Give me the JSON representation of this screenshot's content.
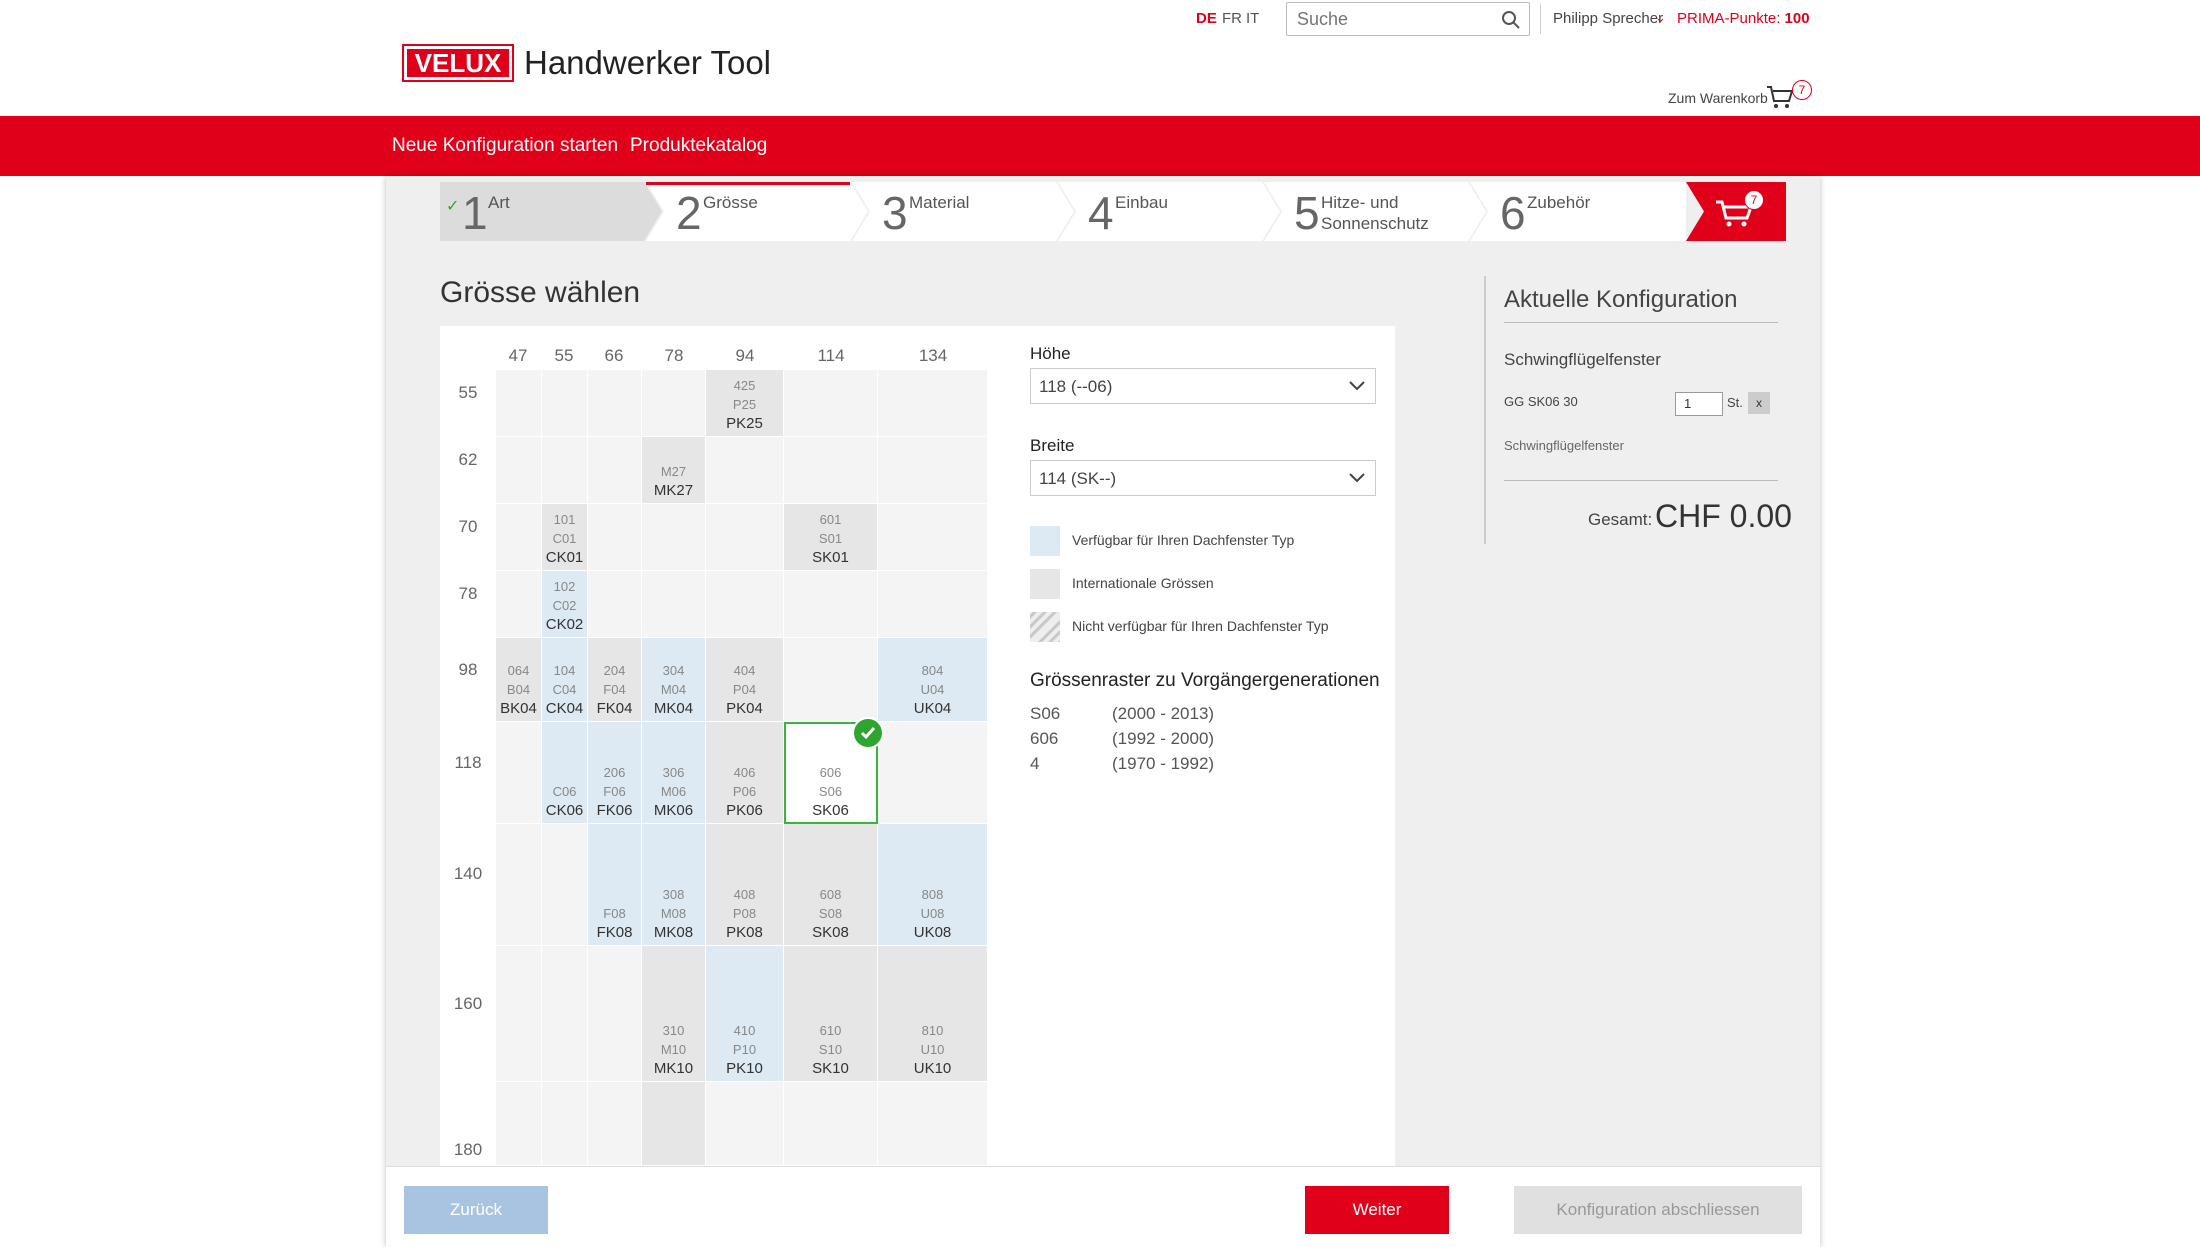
{
  "header": {
    "logo": "VELUX",
    "app_title": "Handwerker Tool",
    "languages": [
      "DE",
      "FR",
      "IT"
    ],
    "search_placeholder": "Suche",
    "user_name": "Philipp Sprecher",
    "points_label": "PRIMA-Punkte:",
    "points_value": "100",
    "cart_link": "Zum Warenkorb",
    "cart_count": "7"
  },
  "nav": {
    "new_config": "Neue Konfiguration starten",
    "catalog": "Produktekatalog"
  },
  "steps": [
    {
      "num": "1",
      "label": "Art"
    },
    {
      "num": "2",
      "label": "Grösse"
    },
    {
      "num": "3",
      "label": "Material"
    },
    {
      "num": "4",
      "label": "Einbau"
    },
    {
      "num": "5",
      "label": "Hitze- und Sonnenschutz"
    },
    {
      "num": "6",
      "label": "Zubehör"
    }
  ],
  "steps_cart_count": "7",
  "section_title": "Grösse wählen",
  "grid": {
    "columns": [
      "47",
      "55",
      "66",
      "78",
      "94",
      "114",
      "134"
    ],
    "rows": [
      "55",
      "62",
      "70",
      "78",
      "98",
      "118",
      "140",
      "160",
      "180"
    ],
    "cells": [
      {
        "row": 0,
        "col": 4,
        "type": "intl",
        "lines": [
          "425",
          "P25"
        ],
        "code": "PK25"
      },
      {
        "row": 1,
        "col": 3,
        "type": "intl",
        "lines": [
          "M27"
        ],
        "code": "MK27"
      },
      {
        "row": 2,
        "col": 1,
        "type": "intl",
        "lines": [
          "101",
          "C01"
        ],
        "code": "CK01"
      },
      {
        "row": 2,
        "col": 5,
        "type": "intl",
        "lines": [
          "601",
          "S01"
        ],
        "code": "SK01"
      },
      {
        "row": 3,
        "col": 1,
        "type": "avail",
        "lines": [
          "102",
          "C02"
        ],
        "code": "CK02"
      },
      {
        "row": 4,
        "col": 0,
        "type": "intl",
        "lines": [
          "064",
          "B04"
        ],
        "code": "BK04"
      },
      {
        "row": 4,
        "col": 1,
        "type": "avail",
        "lines": [
          "104",
          "C04"
        ],
        "code": "CK04"
      },
      {
        "row": 4,
        "col": 2,
        "type": "intl",
        "lines": [
          "204",
          "F04"
        ],
        "code": "FK04"
      },
      {
        "row": 4,
        "col": 3,
        "type": "avail",
        "lines": [
          "304",
          "M04"
        ],
        "code": "MK04"
      },
      {
        "row": 4,
        "col": 4,
        "type": "intl",
        "lines": [
          "404",
          "P04"
        ],
        "code": "PK04"
      },
      {
        "row": 4,
        "col": 6,
        "type": "avail",
        "lines": [
          "804",
          "U04"
        ],
        "code": "UK04"
      },
      {
        "row": 5,
        "col": 1,
        "type": "avail",
        "lines": [
          "C06"
        ],
        "code": "CK06"
      },
      {
        "row": 5,
        "col": 2,
        "type": "avail",
        "lines": [
          "206",
          "F06"
        ],
        "code": "FK06"
      },
      {
        "row": 5,
        "col": 3,
        "type": "avail",
        "lines": [
          "306",
          "M06"
        ],
        "code": "MK06"
      },
      {
        "row": 5,
        "col": 4,
        "type": "intl",
        "lines": [
          "406",
          "P06"
        ],
        "code": "PK06"
      },
      {
        "row": 5,
        "col": 5,
        "type": "selected",
        "lines": [
          "606",
          "S06"
        ],
        "code": "SK06"
      },
      {
        "row": 6,
        "col": 2,
        "type": "avail",
        "lines": [
          "F08"
        ],
        "code": "FK08"
      },
      {
        "row": 6,
        "col": 3,
        "type": "avail",
        "lines": [
          "308",
          "M08"
        ],
        "code": "MK08"
      },
      {
        "row": 6,
        "col": 4,
        "type": "intl",
        "lines": [
          "408",
          "P08"
        ],
        "code": "PK08"
      },
      {
        "row": 6,
        "col": 5,
        "type": "intl",
        "lines": [
          "608",
          "S08"
        ],
        "code": "SK08"
      },
      {
        "row": 6,
        "col": 6,
        "type": "avail",
        "lines": [
          "808",
          "U08"
        ],
        "code": "UK08"
      },
      {
        "row": 7,
        "col": 3,
        "type": "intl",
        "lines": [
          "310",
          "M10"
        ],
        "code": "MK10"
      },
      {
        "row": 7,
        "col": 4,
        "type": "avail",
        "lines": [
          "410",
          "P10"
        ],
        "code": "PK10"
      },
      {
        "row": 7,
        "col": 5,
        "type": "intl",
        "lines": [
          "610",
          "S10"
        ],
        "code": "SK10"
      },
      {
        "row": 7,
        "col": 6,
        "type": "intl",
        "lines": [
          "810",
          "U10"
        ],
        "code": "UK10"
      },
      {
        "row": 8,
        "col": 3,
        "type": "intl",
        "lines": [],
        "code": ""
      }
    ]
  },
  "filters": {
    "height_label": "Höhe",
    "height_value": "118 (--06)",
    "width_label": "Breite",
    "width_value": "114 (SK--)"
  },
  "legend": [
    {
      "text": "Verfügbar für Ihren Dachfenster Typ",
      "color": "#dde9f3"
    },
    {
      "text": "Internationale Grössen",
      "color": "#e6e6e6"
    },
    {
      "text": "Nicht verfügbar für Ihren Dachfenster Typ",
      "color": "hatched"
    }
  ],
  "previous": {
    "title": "Grössenraster zu Vorgängergenerationen",
    "rows": [
      {
        "code": "S06",
        "years": "(2000 - 2013)"
      },
      {
        "code": "606",
        "years": "(1992 - 2000)"
      },
      {
        "code": "4",
        "years": "(1970 - 1992)"
      }
    ]
  },
  "config": {
    "title": "Aktuelle Konfiguration",
    "type": "Schwingflügelfenster",
    "code": "GG SK06 30",
    "qty": "1",
    "qty_unit": "St.",
    "remove": "x",
    "subtitle": "Schwingflügelfenster",
    "total_label": "Gesamt:",
    "total_value": "CHF 0.00"
  },
  "buttons": {
    "back": "Zurück",
    "next": "Weiter",
    "finish": "Konfiguration abschliessen"
  },
  "colors": {
    "brand": "#e1001a",
    "available": "#dde9f3",
    "international": "#e6e6e6",
    "selected_outline": "#3cb43c"
  }
}
